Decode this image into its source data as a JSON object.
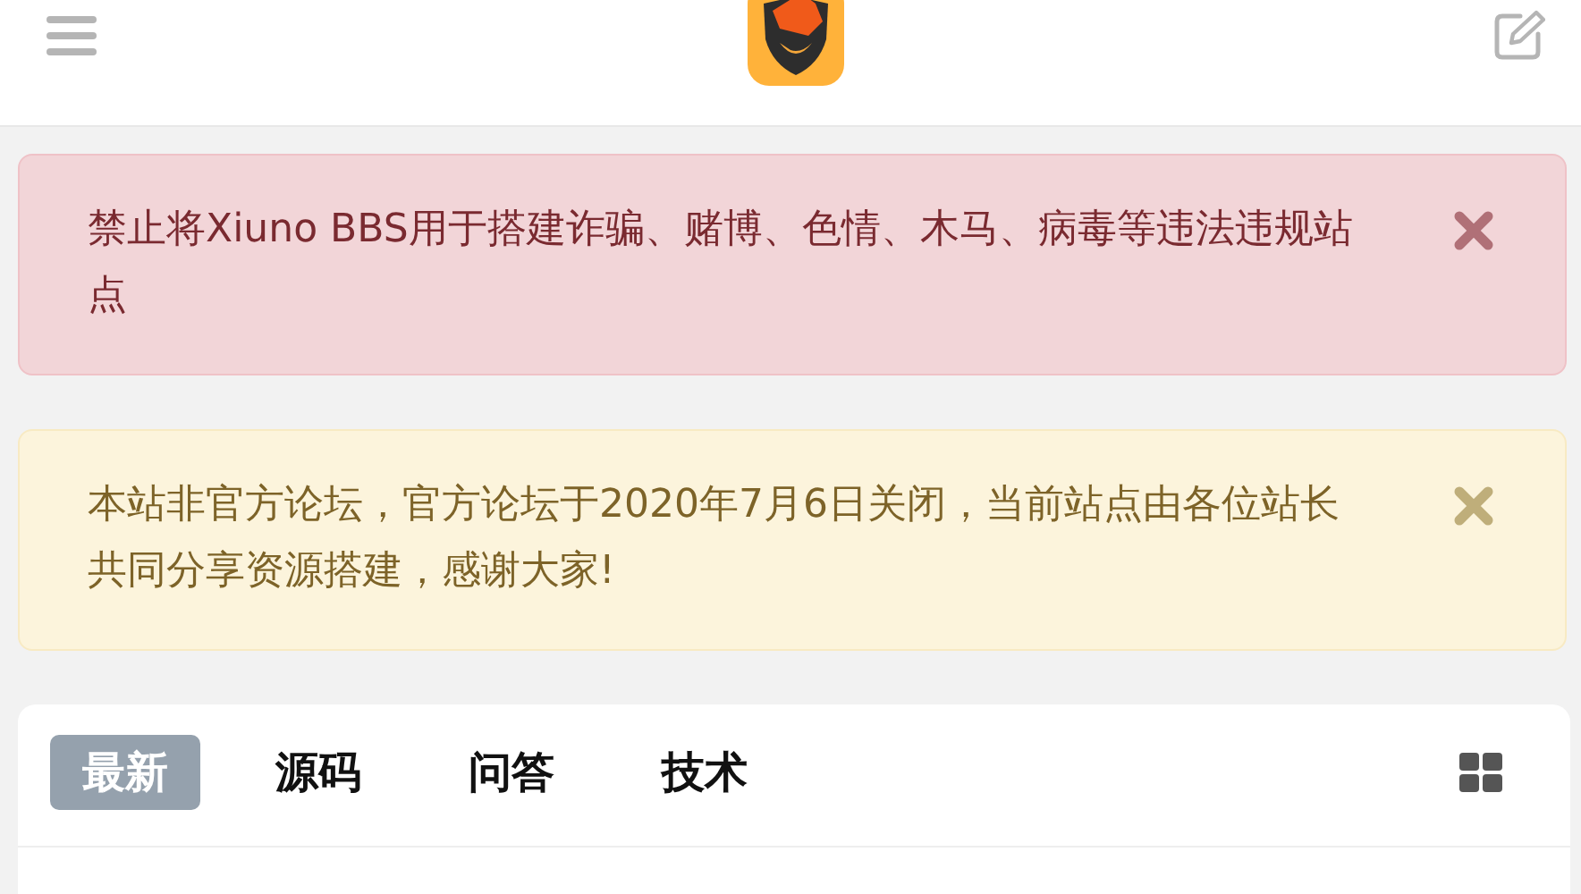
{
  "alerts": [
    {
      "kind": "danger",
      "text": "禁止将Xiuno BBS用于搭建诈骗、赌博、色情、木马、病毒等违法违规站点"
    },
    {
      "kind": "warning",
      "text": "本站非官方论坛，官方论坛于2020年7月6日关闭，当前站点由各位站长共同分享资源搭建，感谢大家!"
    }
  ],
  "tabs": [
    {
      "label": "最新",
      "selected": true
    },
    {
      "label": "源码",
      "selected": false
    },
    {
      "label": "问答",
      "selected": false
    },
    {
      "label": "技术",
      "selected": false
    }
  ]
}
